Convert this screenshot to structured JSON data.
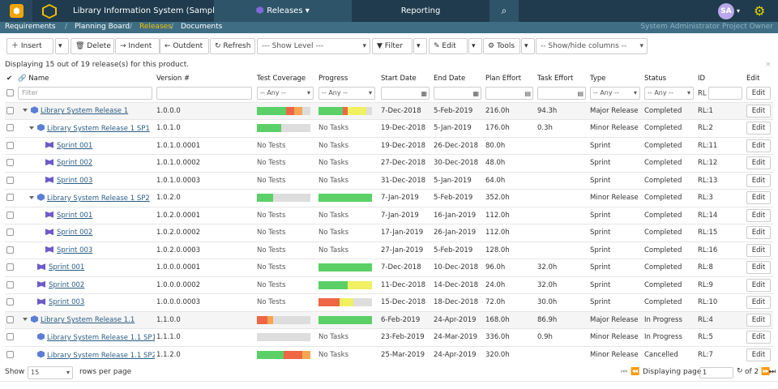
{
  "topbar": {
    "project": "Library Information System (Sample)",
    "releases_tab": "Releases",
    "reporting_tab": "Reporting",
    "avatar": "SA"
  },
  "subnav": {
    "requirements": "Requirements",
    "planning": "Planning Board",
    "releases": "Releases",
    "documents": "Documents",
    "user": "System Administrator  Project Owner"
  },
  "toolbar": {
    "insert": "Insert",
    "delete": "Delete",
    "indent": "Indent",
    "outdent": "Outdent",
    "refresh": "Refresh",
    "show_level": "--- Show Level ---",
    "filter": "Filter",
    "edit": "Edit",
    "tools": "Tools",
    "show_hide": "-- Show/hide columns --"
  },
  "display_text": "Displaying 15 out of 19 release(s) for this product.",
  "columns": [
    "Name",
    "Version #",
    "Test Coverage",
    "Progress",
    "Start Date",
    "End Date",
    "Plan Effort",
    "Task Effort",
    "Type",
    "Status",
    "ID",
    "Edit"
  ],
  "filters": {
    "name_placeholder": "Filter",
    "any": "-- Any --",
    "id_prefix": "RL"
  },
  "colors": {
    "green": "#5ad067",
    "red": "#ee6644",
    "orange": "#f5a54f",
    "yellow": "#f1f060",
    "gray": "#dcdcdc"
  },
  "rows": [
    {
      "name": "Library System Release 1",
      "icon": "release",
      "level": 1,
      "tree": true,
      "version": "1.0.0.0",
      "coverage": [
        0.55,
        0.15,
        0.15,
        0.15
      ],
      "coverage_text": "",
      "progress": [
        0.45,
        0.1,
        0.35
      ],
      "progress_text": "",
      "start": "7-Dec-2018",
      "end": "5-Feb-2019",
      "plan": "216.0h",
      "task": "94.3h",
      "type": "Major Release",
      "status": "Completed",
      "id": "RL:1",
      "edit": "Edit"
    },
    {
      "name": "Library System Release 1 SP1",
      "icon": "release",
      "level": 2,
      "tree": true,
      "version": "1.0.1.0",
      "coverage": [
        0.45,
        0,
        0,
        0.15
      ],
      "coverage_text": "",
      "progress": null,
      "progress_text": "No Tasks",
      "start": "19-Dec-2018",
      "end": "5-Jan-2019",
      "plan": "176.0h",
      "task": "0.3h",
      "type": "Minor Release",
      "status": "Completed",
      "id": "RL:2",
      "edit": "Edit"
    },
    {
      "name": "Sprint 001",
      "icon": "sprint",
      "level": 3,
      "tree": false,
      "version": "1.0.1.0.0001",
      "coverage": null,
      "coverage_text": "No Tests",
      "progress": null,
      "progress_text": "No Tasks",
      "start": "19-Dec-2018",
      "end": "26-Dec-2018",
      "plan": "80.0h",
      "task": "",
      "type": "Sprint",
      "status": "Completed",
      "id": "RL:11",
      "edit": "Edit"
    },
    {
      "name": "Sprint 002",
      "icon": "sprint",
      "level": 3,
      "tree": false,
      "version": "1.0.1.0.0002",
      "coverage": null,
      "coverage_text": "No Tests",
      "progress": null,
      "progress_text": "No Tasks",
      "start": "27-Dec-2018",
      "end": "30-Dec-2018",
      "plan": "48.0h",
      "task": "",
      "type": "Sprint",
      "status": "Completed",
      "id": "RL:12",
      "edit": "Edit"
    },
    {
      "name": "Sprint 003",
      "icon": "sprint",
      "level": 3,
      "tree": false,
      "version": "1.0.1.0.0003",
      "coverage": null,
      "coverage_text": "No Tests",
      "progress": null,
      "progress_text": "No Tasks",
      "start": "31-Dec-2018",
      "end": "5-Jan-2019",
      "plan": "64.0h",
      "task": "",
      "type": "Sprint",
      "status": "Completed",
      "id": "RL:13",
      "edit": "Edit"
    },
    {
      "name": "Library System Release 1 SP2",
      "icon": "release",
      "level": 2,
      "tree": true,
      "version": "1.0.2.0",
      "coverage": [
        0.3,
        0,
        0,
        0
      ],
      "coverage_text": "",
      "progress": [
        1,
        0,
        0
      ],
      "progress_text": "",
      "start": "7-Jan-2019",
      "end": "5-Feb-2019",
      "plan": "352.0h",
      "task": "",
      "type": "Minor Release",
      "status": "Completed",
      "id": "RL:3",
      "edit": "Edit"
    },
    {
      "name": "Sprint 001",
      "icon": "sprint",
      "level": 3,
      "tree": false,
      "version": "1.0.2.0.0001",
      "coverage": null,
      "coverage_text": "No Tests",
      "progress": null,
      "progress_text": "No Tasks",
      "start": "7-Jan-2019",
      "end": "16-Jan-2019",
      "plan": "112.0h",
      "task": "",
      "type": "Sprint",
      "status": "Completed",
      "id": "RL:14",
      "edit": "Edit"
    },
    {
      "name": "Sprint 002",
      "icon": "sprint",
      "level": 3,
      "tree": false,
      "version": "1.0.2.0.0002",
      "coverage": null,
      "coverage_text": "No Tests",
      "progress": null,
      "progress_text": "No Tasks",
      "start": "17-Jan-2019",
      "end": "26-Jan-2019",
      "plan": "112.0h",
      "task": "",
      "type": "Sprint",
      "status": "Completed",
      "id": "RL:15",
      "edit": "Edit"
    },
    {
      "name": "Sprint 003",
      "icon": "sprint",
      "level": 3,
      "tree": false,
      "version": "1.0.2.0.0003",
      "coverage": null,
      "coverage_text": "No Tests",
      "progress": null,
      "progress_text": "No Tasks",
      "start": "27-Jan-2019",
      "end": "5-Feb-2019",
      "plan": "128.0h",
      "task": "",
      "type": "Sprint",
      "status": "Completed",
      "id": "RL:16",
      "edit": "Edit"
    },
    {
      "name": "Sprint 001",
      "icon": "sprint",
      "level": 2,
      "tree": false,
      "version": "1.0.0.0.0001",
      "coverage": null,
      "coverage_text": "No Tests",
      "progress": [
        1,
        0,
        0
      ],
      "progress_text": "",
      "start": "7-Dec-2018",
      "end": "10-Dec-2018",
      "plan": "96.0h",
      "task": "32.0h",
      "type": "Sprint",
      "status": "Completed",
      "id": "RL:8",
      "edit": "Edit"
    },
    {
      "name": "Sprint 002",
      "icon": "sprint",
      "level": 2,
      "tree": false,
      "version": "1.0.0.0.0002",
      "coverage": null,
      "coverage_text": "No Tests",
      "progress": [
        0.55,
        0,
        0.45
      ],
      "progress_text": "",
      "start": "11-Dec-2018",
      "end": "14-Dec-2018",
      "plan": "24.0h",
      "task": "32.0h",
      "type": "Sprint",
      "status": "Completed",
      "id": "RL:9",
      "edit": "Edit"
    },
    {
      "name": "Sprint 003",
      "icon": "sprint",
      "level": 2,
      "tree": false,
      "version": "1.0.0.0.0003",
      "coverage": null,
      "coverage_text": "No Tests",
      "progress": [
        0,
        0.4,
        0.25
      ],
      "progress_text": "",
      "start": "15-Dec-2018",
      "end": "18-Dec-2018",
      "plan": "72.0h",
      "task": "30.0h",
      "type": "Sprint",
      "status": "Completed",
      "id": "RL:10",
      "edit": "Edit"
    },
    {
      "name": "Library System Release 1.1",
      "icon": "release",
      "level": 1,
      "tree": true,
      "version": "1.1.0.0",
      "coverage": [
        0,
        0.2,
        0.1,
        0
      ],
      "coverage_text": "",
      "progress": [
        1,
        0,
        0
      ],
      "progress_text": "",
      "start": "6-Feb-2019",
      "end": "24-Apr-2019",
      "plan": "168.0h",
      "task": "86.9h",
      "type": "Major Release",
      "status": "In Progress",
      "id": "RL:4",
      "edit": "Edit"
    },
    {
      "name": "Library System Release 1.1 SP1",
      "icon": "release",
      "level": 2,
      "tree": false,
      "version": "1.1.1.0",
      "coverage": [
        0,
        0,
        0,
        0
      ],
      "coverage_text": "",
      "progress": null,
      "progress_text": "No Tasks",
      "start": "23-Feb-2019",
      "end": "24-Mar-2019",
      "plan": "336.0h",
      "task": "0.9h",
      "type": "Minor Release",
      "status": "In Progress",
      "id": "RL:5",
      "edit": "Edit"
    },
    {
      "name": "Library System Release 1.1 SP2",
      "icon": "release",
      "level": 2,
      "tree": false,
      "version": "1.1.2.0",
      "coverage": [
        0.5,
        0.35,
        0.15,
        0
      ],
      "coverage_text": "",
      "progress": null,
      "progress_text": "No Tasks",
      "start": "25-Mar-2019",
      "end": "24-Apr-2019",
      "plan": "320.0h",
      "task": "",
      "type": "Minor Release",
      "status": "Cancelled",
      "id": "RL:7",
      "edit": "Edit"
    }
  ],
  "footer": {
    "show": "Show",
    "rows_per_page": "15",
    "rows_label": "rows per page",
    "displaying_page": "Displaying page",
    "page": "1",
    "of_pages": "of 2"
  }
}
